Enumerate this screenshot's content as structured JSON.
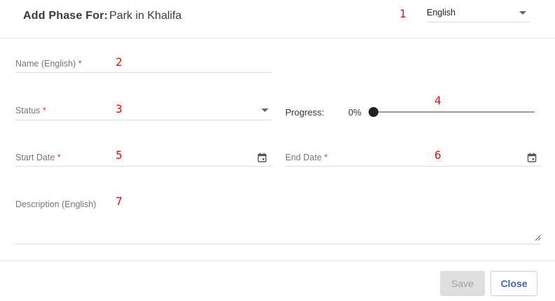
{
  "header": {
    "title_prefix": "Add Phase For:",
    "project_name": "Park in Khalifa",
    "language": {
      "selected": "English"
    }
  },
  "annotations": [
    "1",
    "2",
    "3",
    "4",
    "5",
    "6",
    "7"
  ],
  "form": {
    "name": {
      "label": "Name (English)",
      "required_mark": "*",
      "value": ""
    },
    "status": {
      "label": "Status",
      "required_mark": "*",
      "value": ""
    },
    "progress": {
      "label": "Progress:",
      "value_text": "0%",
      "value": 0
    },
    "start_date": {
      "label": "Start Date",
      "required_mark": "*",
      "value": ""
    },
    "end_date": {
      "label": "End Date",
      "required_mark": "*",
      "value": ""
    },
    "description": {
      "label": "Description (English)",
      "value": ""
    }
  },
  "footer": {
    "save_label": "Save",
    "close_label": "Close"
  },
  "colors": {
    "accent": "#3f64c4",
    "required": "#e53935",
    "annotation": "#dd1111",
    "disabled_button": "#dedede"
  },
  "icons": {
    "dropdown": "chevron-down-icon",
    "calendar": "calendar-icon",
    "resize": "resize-grip-icon"
  }
}
